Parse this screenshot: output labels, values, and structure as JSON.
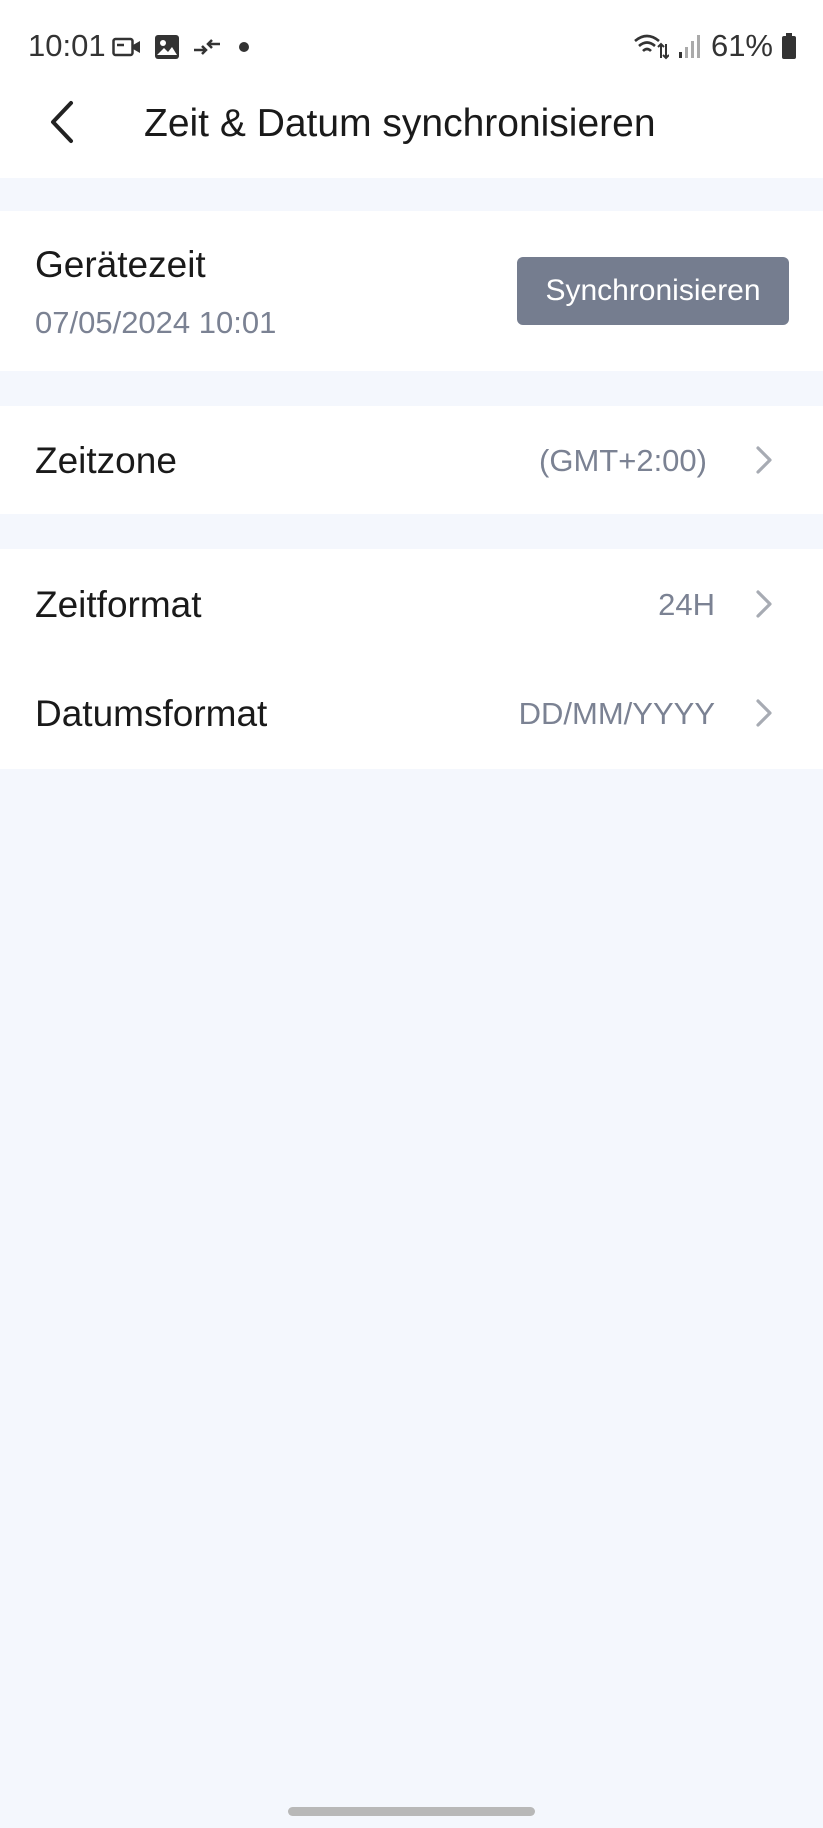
{
  "status_bar": {
    "time": "10:01",
    "battery": "61%",
    "icons": [
      "video-call-icon",
      "gallery-icon",
      "data-transfer-icon",
      "notification-dot-icon",
      "wifi-icon",
      "signal-icon",
      "battery-icon"
    ]
  },
  "header": {
    "title": "Zeit & Datum synchronisieren",
    "back_icon": "chevron-left-icon"
  },
  "device_time": {
    "label": "Gerätezeit",
    "value": "07/05/2024 10:01",
    "sync_button": "Synchronisieren"
  },
  "timezone": {
    "label": "Zeitzone",
    "value": "(GMT+2:00)"
  },
  "formats": {
    "time_format_label": "Zeitformat",
    "time_format_value": "24H",
    "date_format_label": "Datumsformat",
    "date_format_value": "DD/MM/YYYY"
  },
  "colors": {
    "background": "#f4f7fd",
    "card": "#ffffff",
    "button": "#757d8f",
    "secondary_text": "#7b8293",
    "chevron": "#a7abb3"
  }
}
